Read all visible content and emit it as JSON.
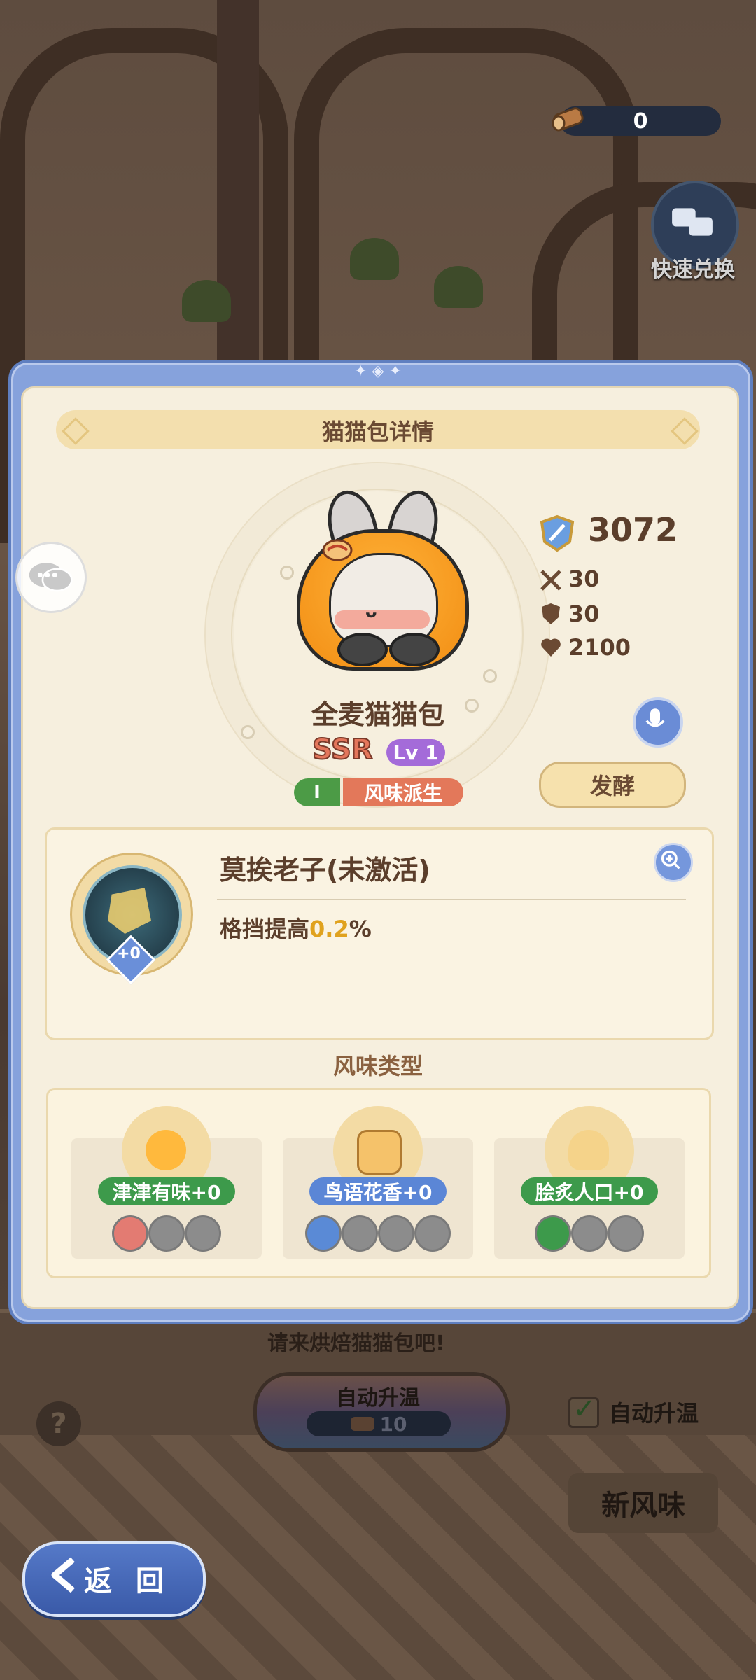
{
  "hud": {
    "currency_value": "0",
    "quick_exchange_label": "快速兑换"
  },
  "modal": {
    "title": "猫猫包详情",
    "character": {
      "name": "全麦猫猫包",
      "rarity": "SSR",
      "level": "Lv 1",
      "tier": "I",
      "type": "风味派生"
    },
    "stats": {
      "power": "3072",
      "attack": "30",
      "defense": "30",
      "hp": "2100"
    },
    "ferment_label": "发酵",
    "skill": {
      "name": "莫挨老子(未激活)",
      "desc_prefix": "格挡提高",
      "desc_value": "0.2",
      "desc_suffix": "%",
      "level_badge": "+0"
    },
    "flavor_section_label": "风味类型",
    "flavors": [
      {
        "label": "津津有味+0",
        "color": "#3d9a4b"
      },
      {
        "label": "鸟语花香+0",
        "color": "#5b86d6"
      },
      {
        "label": "脍炙人口+0",
        "color": "#3d9a4b"
      }
    ]
  },
  "background": {
    "prompt": "请来烘焙猫猫包吧!",
    "auto_heat_label": "自动升温",
    "auto_heat_cost": "10",
    "auto_heat_toggle_label": "自动升温",
    "new_flavor_label": "新风味",
    "help_label": "?",
    "back_label": "返 回"
  }
}
